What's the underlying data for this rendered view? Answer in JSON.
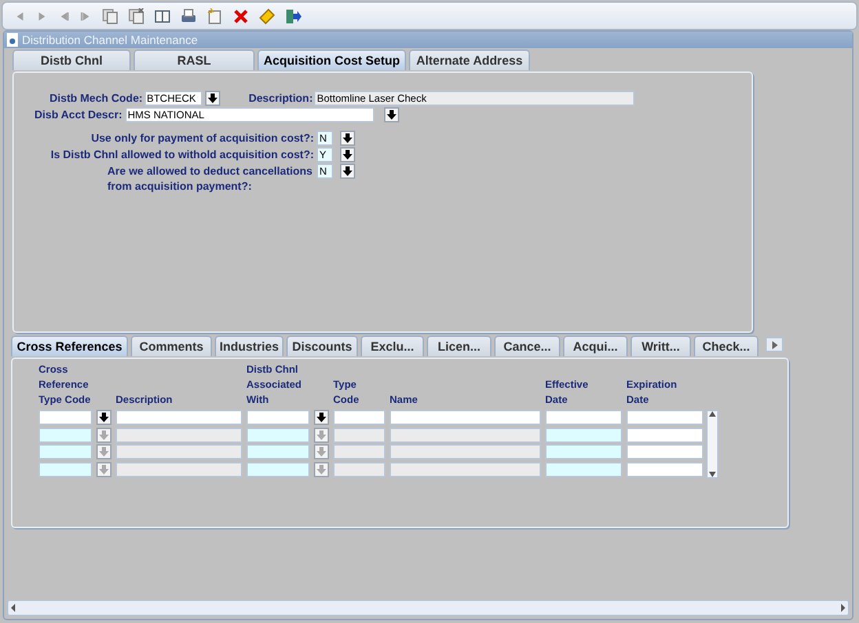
{
  "window": {
    "title": "Distribution Channel Maintenance"
  },
  "tabs": [
    {
      "label": "Distb Chnl",
      "selected": false
    },
    {
      "label": "RASL",
      "selected": false
    },
    {
      "label": "Acquisition Cost Setup",
      "selected": true
    },
    {
      "label": "Alternate Address",
      "selected": false
    }
  ],
  "header_fields": [
    {
      "label": "Distb Mech Code:",
      "value": "BTCHECK",
      "kind": "code"
    },
    {
      "label": "Description:",
      "value": "Bottomline Laser Check",
      "kind": "readonly"
    },
    {
      "label": "Disb Acct Descr:",
      "value": "HMS NATIONAL",
      "kind": "wide"
    }
  ],
  "questions": [
    {
      "label": "Use only for payment of acquisition cost?:",
      "value": "N"
    },
    {
      "label": "Is Distb Chnl allowed to withold acquisition cost?:",
      "value": "Y"
    },
    {
      "label": "Are we allowed to deduct cancellations from acquisition payment?:",
      "value": "N"
    }
  ],
  "subtabs": [
    {
      "label": "Cross References",
      "selected": true
    },
    {
      "label": "Comments",
      "selected": false
    },
    {
      "label": "Industries",
      "selected": false
    },
    {
      "label": "Discounts",
      "selected": false
    },
    {
      "label": "Exclu...",
      "selected": false
    },
    {
      "label": "Licen...",
      "selected": false
    },
    {
      "label": "Cance...",
      "selected": false
    },
    {
      "label": "Acqui...",
      "selected": false
    },
    {
      "label": "Writt...",
      "selected": false
    },
    {
      "label": "Check...",
      "selected": false
    }
  ],
  "grid": {
    "columns": [
      {
        "label": "Cross Reference Type Code",
        "kind": "lookup"
      },
      {
        "label": "Description",
        "kind": "display"
      },
      {
        "label": "Distb Chnl Associated With",
        "kind": "lookup"
      },
      {
        "label": "Type Code",
        "kind": "display"
      },
      {
        "label": "Name",
        "kind": "display"
      },
      {
        "label": "Effective Date",
        "kind": "required"
      },
      {
        "label": "Expiration Date",
        "kind": "optional"
      }
    ],
    "rows": [
      {
        "active": true
      },
      {
        "active": false
      },
      {
        "active": false
      },
      {
        "active": false
      }
    ]
  }
}
